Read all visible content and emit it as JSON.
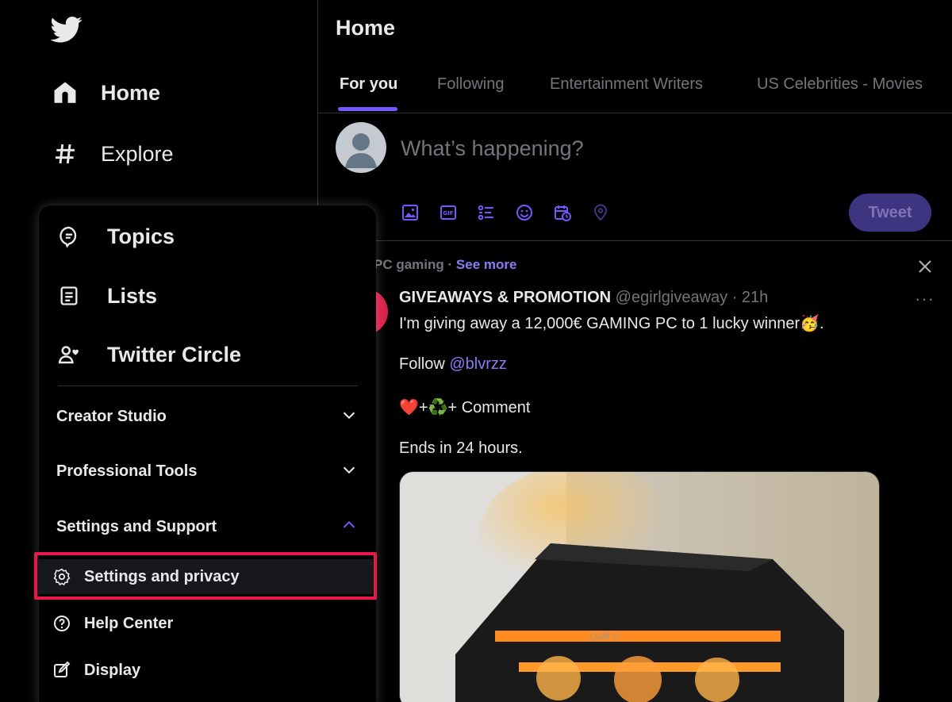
{
  "nav": {
    "items": [
      {
        "label": "Home",
        "icon": "home-icon"
      },
      {
        "label": "Explore",
        "icon": "hashtag-icon"
      }
    ]
  },
  "main": {
    "title": "Home",
    "tabs": [
      {
        "label": "For you",
        "active": true
      },
      {
        "label": "Following"
      },
      {
        "label": "Entertainment Writers"
      },
      {
        "label": "US Celebrities - Movies"
      }
    ],
    "composer": {
      "placeholder": "What’s happening?",
      "tweet_button": "Tweet",
      "tools": [
        "image-icon",
        "gif-icon",
        "poll-icon",
        "emoji-icon",
        "schedule-icon",
        "location-icon"
      ]
    },
    "post": {
      "topic": "PC gaming",
      "separator": " · ",
      "see_more": "See more",
      "name": "GIVEAWAYS & PROMOTION",
      "handle": "@egirlgiveaway · 21h",
      "more": "···",
      "line1": "I'm giving away a 12,000€ GAMING PC to 1 lucky winner🥳.",
      "follow_prefix": "Follow ",
      "follow_mention": "@blvrzz",
      "line3": "❤️+♻️+ Comment",
      "line4": "Ends in 24 hours.",
      "media_text": "LIAN LI"
    }
  },
  "menu": {
    "primary": [
      {
        "label": "Topics",
        "icon": "topics-icon"
      },
      {
        "label": "Lists",
        "icon": "lists-icon"
      },
      {
        "label": "Twitter Circle",
        "icon": "circle-icon"
      }
    ],
    "sections": [
      {
        "label": "Creator Studio",
        "expanded": false
      },
      {
        "label": "Professional Tools",
        "expanded": false
      },
      {
        "label": "Settings and Support",
        "expanded": true
      }
    ],
    "sub_items": [
      {
        "label": "Settings and privacy",
        "icon": "gear-icon",
        "highlighted": true
      },
      {
        "label": "Help Center",
        "icon": "help-icon"
      },
      {
        "label": "Display",
        "icon": "display-icon"
      }
    ]
  },
  "colors": {
    "accent": "#7856ff",
    "highlight": "#e8184e",
    "tweet_button_bg": "#3e3580"
  }
}
